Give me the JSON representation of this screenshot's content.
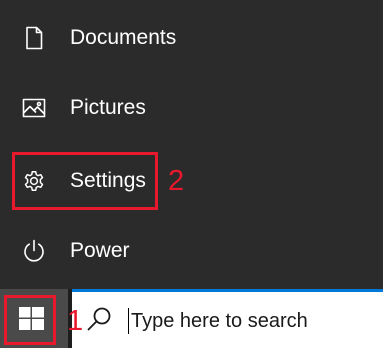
{
  "start_menu": {
    "items": [
      {
        "label": "Documents",
        "icon": "document-icon"
      },
      {
        "label": "Pictures",
        "icon": "pictures-icon"
      },
      {
        "label": "Settings",
        "icon": "gear-icon"
      },
      {
        "label": "Power",
        "icon": "power-icon"
      }
    ]
  },
  "annotations": {
    "start_number": "1",
    "settings_number": "2",
    "color": "#e8192c"
  },
  "taskbar": {
    "start_icon": "windows-logo-icon",
    "search": {
      "icon": "search-icon",
      "placeholder": "Type here to search"
    }
  },
  "colors": {
    "menu_background": "#2b2b2b",
    "taskbar_background": "#1d1d1d",
    "start_button_background": "#4a4a4a",
    "search_accent": "#0078d7"
  }
}
